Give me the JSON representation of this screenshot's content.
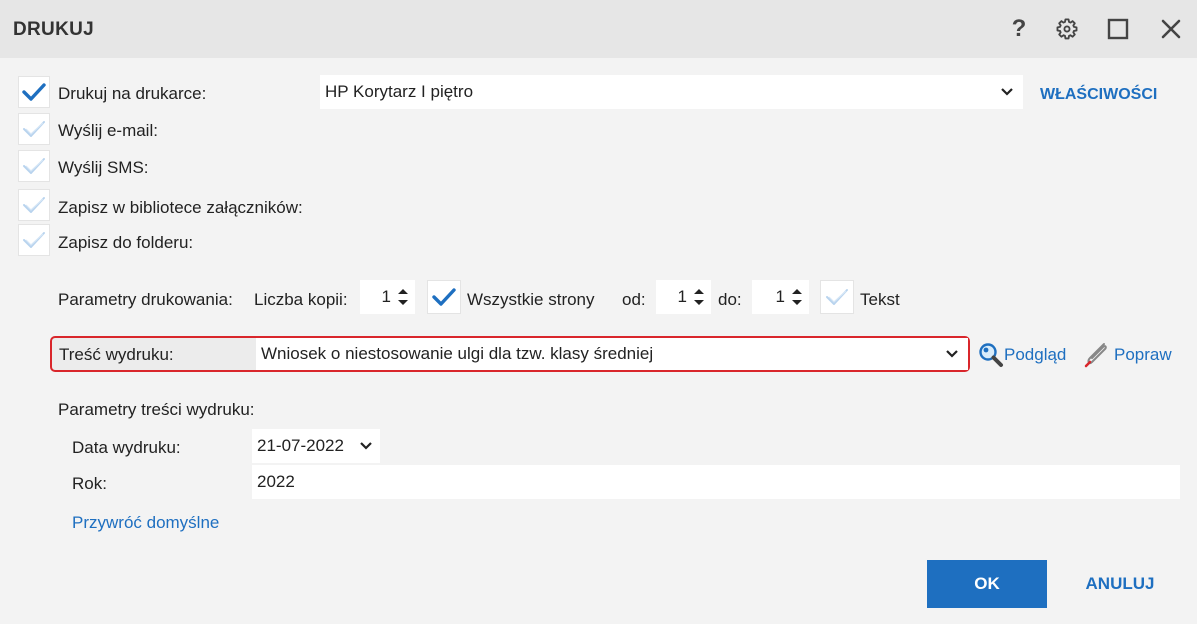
{
  "window": {
    "title": "DRUKUJ",
    "help_label": "?"
  },
  "outputs": [
    {
      "label": "Drukuj na drukarce:",
      "checked": true
    },
    {
      "label": "Wyślij e-mail:",
      "checked": false
    },
    {
      "label": "Wyślij SMS:",
      "checked": false
    },
    {
      "label": "Zapisz w bibliotece załączników:",
      "checked": false
    },
    {
      "label": "Zapisz do folderu:",
      "checked": false
    }
  ],
  "printer": {
    "selected": "HP Korytarz I piętro",
    "properties_label": "WŁAŚCIWOŚCI"
  },
  "params": {
    "label": "Parametry drukowania:",
    "copies_label": "Liczba kopii:",
    "copies_value": "1",
    "all_pages_label": "Wszystkie strony",
    "all_pages_checked": true,
    "from_label": "od:",
    "from_value": "1",
    "to_label": "do:",
    "to_value": "1",
    "text_label": "Tekst",
    "text_checked": false
  },
  "content": {
    "label": "Treść wydruku:",
    "selected": "Wniosek o niestosowanie ulgi dla tzw. klasy średniej",
    "preview_label": "Podgląd",
    "edit_label": "Popraw"
  },
  "content_params": {
    "label": "Parametry treści wydruku:",
    "date_label": "Data wydruku:",
    "date_value": "21-07-2022",
    "year_label": "Rok:",
    "year_value": "2022",
    "restore_label": "Przywróć domyślne"
  },
  "buttons": {
    "ok": "OK",
    "cancel": "ANULUJ"
  },
  "colors": {
    "accent": "#1e6fc0",
    "check_on": "#1e6fc0",
    "check_off": "#b8d3ee",
    "highlight_border": "#d9262b"
  }
}
